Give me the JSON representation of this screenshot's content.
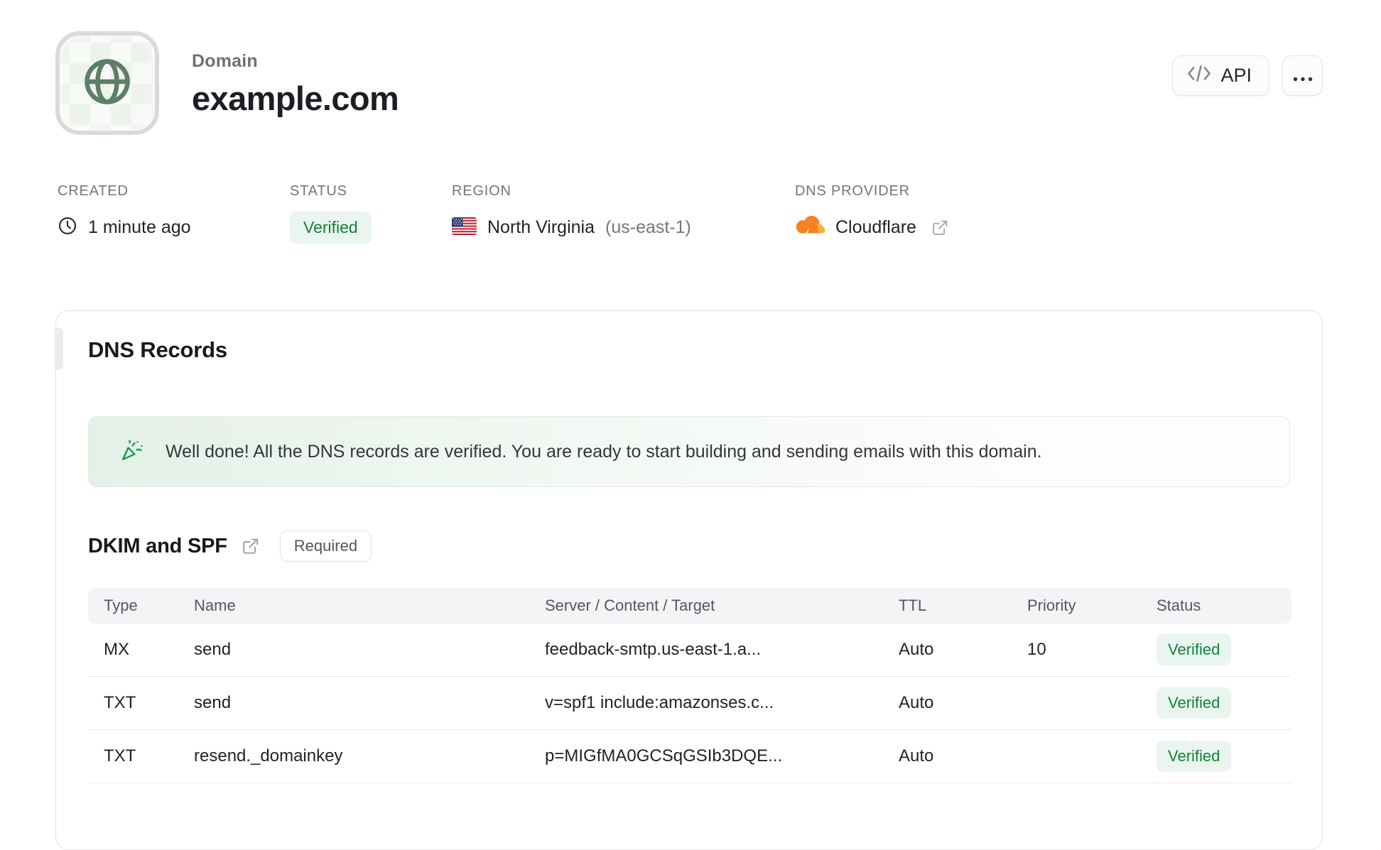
{
  "header": {
    "eyebrow": "Domain",
    "title": "example.com",
    "api_button_label": "API"
  },
  "meta": {
    "created": {
      "label": "CREATED",
      "value": "1 minute ago"
    },
    "status": {
      "label": "STATUS",
      "value": "Verified"
    },
    "region": {
      "label": "REGION",
      "value": "North Virginia",
      "code": "(us-east-1)"
    },
    "dns_provider": {
      "label": "DNS PROVIDER",
      "value": "Cloudflare"
    }
  },
  "card": {
    "title": "DNS Records",
    "banner": {
      "text": "Well done! All the DNS records are verified. You are ready to start building and sending emails with this domain."
    },
    "section": {
      "title": "DKIM and SPF",
      "badge": "Required"
    },
    "table": {
      "columns": [
        "Type",
        "Name",
        "Server / Content / Target",
        "TTL",
        "Priority",
        "Status"
      ],
      "rows": [
        {
          "type": "MX",
          "name": "send",
          "content": "feedback-smtp.us-east-1.a...",
          "ttl": "Auto",
          "priority": "10",
          "status": "Verified"
        },
        {
          "type": "TXT",
          "name": "send",
          "content": "v=spf1 include:amazonses.c...",
          "ttl": "Auto",
          "priority": "",
          "status": "Verified"
        },
        {
          "type": "TXT",
          "name": "resend._domainkey",
          "content": "p=MIGfMA0GCSqGSIb3DQE...",
          "ttl": "Auto",
          "priority": "",
          "status": "Verified"
        }
      ]
    }
  },
  "icons": {
    "avatar": "globe-icon",
    "api": "code-icon",
    "menu": "ellipsis-icon",
    "created": "clock-icon",
    "region": "us-flag-icon",
    "dns_provider": "cloudflare-icon",
    "external_link": "external-link-icon",
    "banner": "party-popper-icon"
  },
  "colors": {
    "verified_text": "#15803d",
    "verified_bg": "#e9f5ee",
    "banner_green": "#16a34a",
    "cloudflare_orange": "#f6821f",
    "globe_green": "#5c7f66",
    "table_header_bg": "#f4f4f6",
    "border": "#e4e4e8"
  }
}
